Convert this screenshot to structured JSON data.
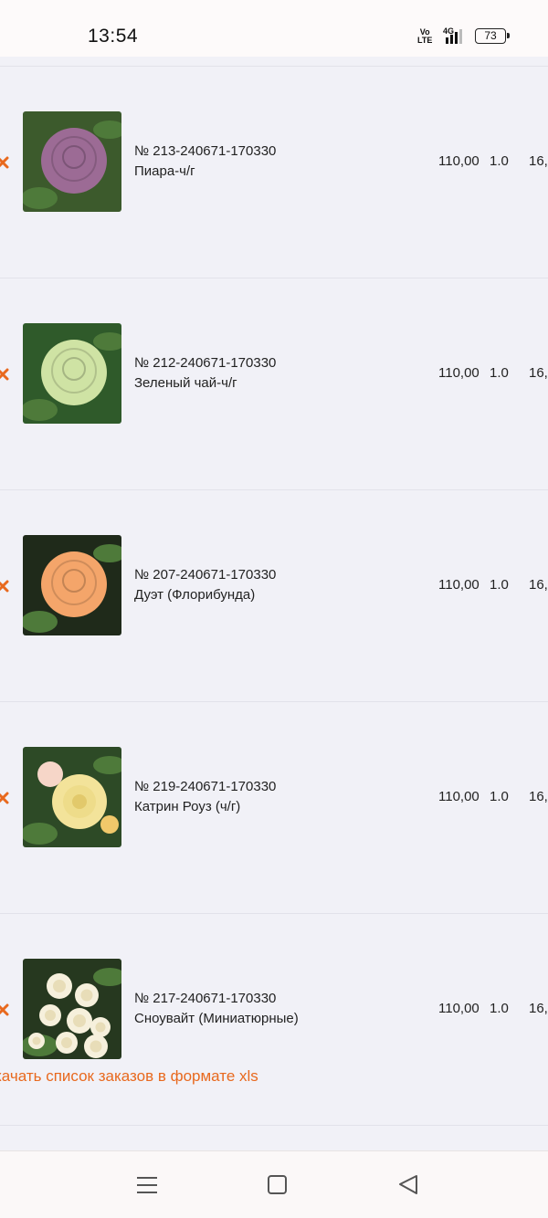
{
  "status_bar": {
    "time": "13:54",
    "volte_line1": "Vo",
    "volte_line2": "LTE",
    "network": "4G",
    "battery": "73"
  },
  "orders": [
    {
      "id": "№ 213-240671-170330",
      "name": "Пиара-ч/г",
      "price": "110,00",
      "qty": "1.0",
      "sum": "16,",
      "image": "purple-rose-photo",
      "flower_color": "#9c6b95"
    },
    {
      "id": "№ 212-240671-170330",
      "name": "Зеленый чай-ч/г",
      "price": "110,00",
      "qty": "1.0",
      "sum": "16,",
      "image": "green-rose-photo",
      "flower_color": "#cfe3a4"
    },
    {
      "id": "№ 207-240671-170330",
      "name": "Дуэт (Флорибунда)",
      "price": "110,00",
      "qty": "1.0",
      "sum": "16,",
      "image": "peach-rose-photo",
      "flower_color": "#f4a56a"
    },
    {
      "id": "№ 219-240671-170330",
      "name": "Катрин Роуз (ч/г)",
      "price": "110,00",
      "qty": "1.0",
      "sum": "16,",
      "image": "yellow-rose-photo",
      "flower_color": "#f3e39a"
    },
    {
      "id": "№ 217-240671-170330",
      "name": "Сноувайт (Миниатюрные)",
      "price": "110,00",
      "qty": "1.0",
      "sum": "16,",
      "image": "white-roses-photo",
      "flower_color": "#f6f0dc"
    }
  ],
  "download_link": "качать список заказов в формате xls",
  "nav": {
    "menu_icon": "menu-icon",
    "home_icon": "home-square-icon",
    "back_icon": "back-triangle-icon"
  },
  "colors": {
    "accent": "#e8691e",
    "background": "#f1f1f7"
  }
}
